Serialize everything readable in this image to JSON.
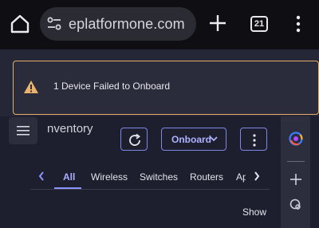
{
  "browser": {
    "url_text": "eplatformone.com",
    "tab_count": "21"
  },
  "toast": {
    "message": "1 Device Failed to Onboard"
  },
  "page": {
    "title": "nventory"
  },
  "toolbar": {
    "onboard_label": "Onboard"
  },
  "tabs": [
    {
      "label": "All",
      "active": true
    },
    {
      "label": "Wireless",
      "active": false
    },
    {
      "label": "Switches",
      "active": false
    },
    {
      "label": "Routers",
      "active": false
    },
    {
      "label": "Ap",
      "active": false
    }
  ],
  "show_label": "Show S",
  "colors": {
    "accent": "#7f86e6",
    "warning": "#e4ad6b",
    "background": "#1e1f2e"
  },
  "icons": [
    "home-icon",
    "tune-icon",
    "plus-icon",
    "tabs-icon",
    "kebab-icon",
    "warning-icon",
    "hamburger-icon",
    "refresh-icon",
    "chevron-down-icon",
    "more-vertical-icon",
    "orb-icon",
    "chevron-left-icon",
    "chevron-right-icon",
    "search-icon"
  ]
}
